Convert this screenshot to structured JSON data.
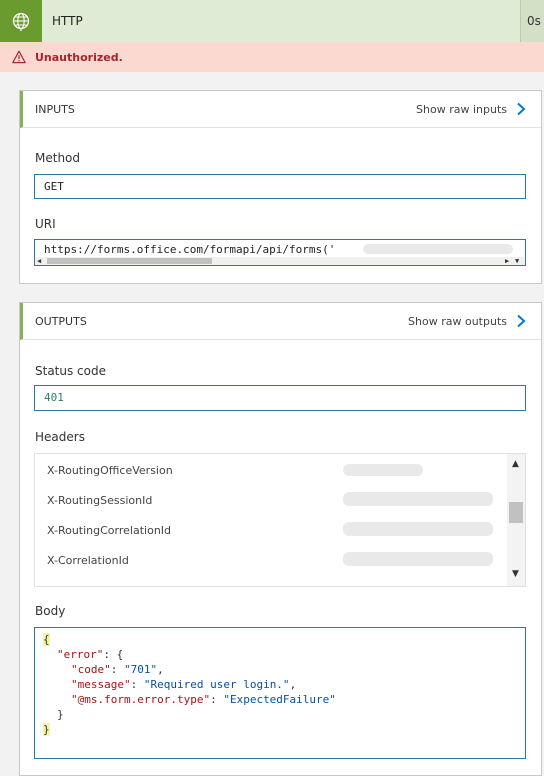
{
  "header": {
    "title": "HTTP",
    "duration": "0s"
  },
  "error": {
    "message": "Unauthorized."
  },
  "inputs": {
    "section_title": "INPUTS",
    "raw_link": "Show raw inputs",
    "method_label": "Method",
    "method_value": "GET",
    "uri_label": "URI",
    "uri_value": "https://forms.office.com/formapi/api/forms('"
  },
  "outputs": {
    "section_title": "OUTPUTS",
    "raw_link": "Show raw outputs",
    "status_label": "Status code",
    "status_value": "401",
    "headers_label": "Headers",
    "headers": [
      {
        "name": "X-RoutingOfficeVersion"
      },
      {
        "name": "X-RoutingSessionId"
      },
      {
        "name": "X-RoutingCorrelationId"
      },
      {
        "name": "X-CorrelationId"
      }
    ],
    "body_label": "Body",
    "body": {
      "open_brace": "{",
      "error_key": "\"error\"",
      "error_open": ": {",
      "code_key": "\"code\"",
      "code_value": "\"701\"",
      "message_key": "\"message\"",
      "message_value": "\"Required user login.\"",
      "type_key": "\"@ms.form.error.type\"",
      "type_value": "\"ExpectedFailure\"",
      "inner_close": "}",
      "close_brace": "}"
    }
  },
  "colors": {
    "accent": "#6a9b2f",
    "error_bg": "#fbd9d0",
    "error_text": "#a4262c",
    "link_chevron": "#0078d4"
  },
  "icons": {
    "action": "globe-icon",
    "error": "warning-icon",
    "raw_link": "chevron-right-icon"
  }
}
